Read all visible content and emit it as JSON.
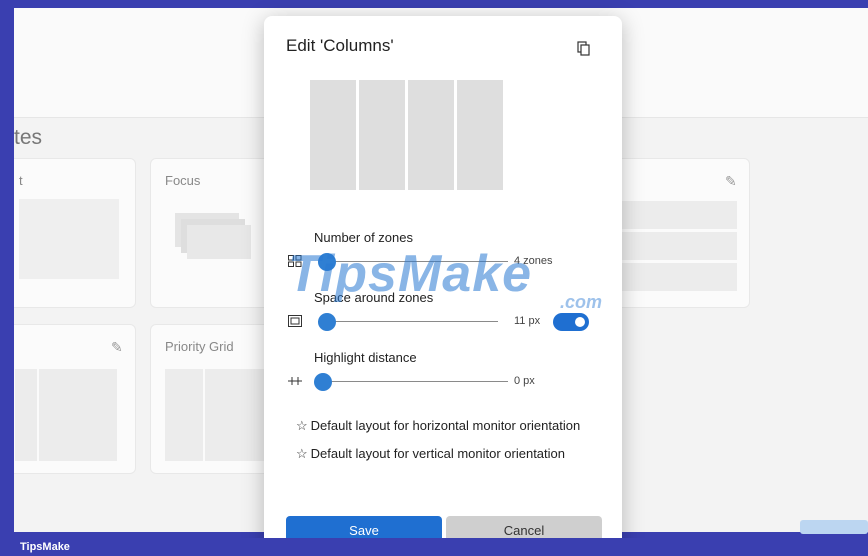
{
  "background": {
    "heading": "tes",
    "cards": [
      {
        "title": "t"
      },
      {
        "title": "Focus"
      },
      {
        "title": "Priority Grid"
      }
    ]
  },
  "dialog": {
    "title": "Edit 'Columns'",
    "preview_columns": 4,
    "sliders": [
      {
        "label": "Number of zones",
        "value_text": "4 zones",
        "level": 0.0,
        "icon": "zones-icon"
      },
      {
        "label": "Space around zones",
        "value_text": "11 px",
        "level": 0.05,
        "icon": "space-icon",
        "toggle": true
      },
      {
        "label": "Highlight distance",
        "value_text": "0 px",
        "level": 0.0,
        "icon": "distance-icon"
      }
    ],
    "defaults": [
      {
        "label": "Default layout for horizontal monitor orientation"
      },
      {
        "label": "Default layout for vertical monitor orientation"
      }
    ],
    "buttons": {
      "save": "Save",
      "cancel": "Cancel"
    }
  },
  "watermark": {
    "text": "TipsMake",
    "suffix": ".com"
  },
  "footer": {
    "brand": "TipsMake"
  },
  "colors": {
    "accent": "#1f6fd1",
    "footer": "#3a3fb0"
  }
}
